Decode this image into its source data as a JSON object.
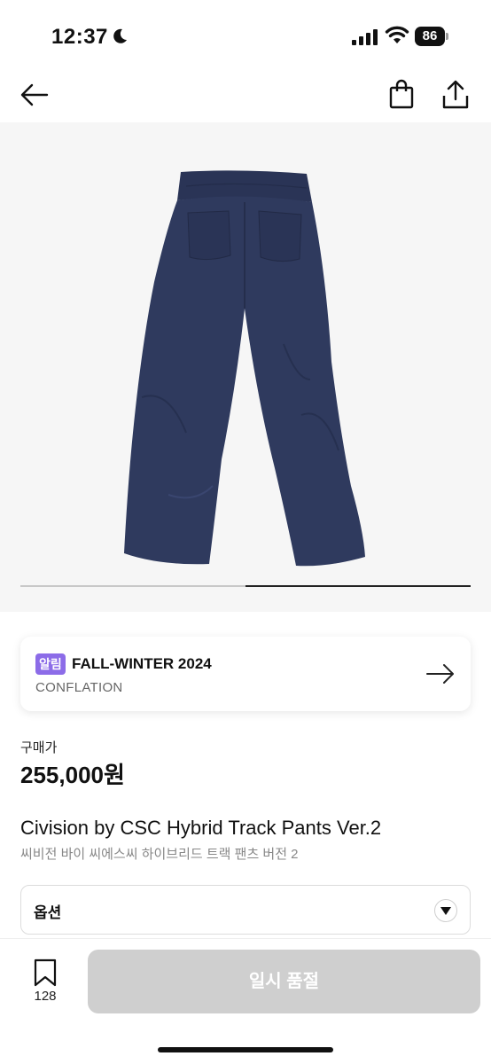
{
  "status_bar": {
    "time": "12:37",
    "battery": "86",
    "icons": [
      "moon-icon",
      "signal-icon",
      "wifi-icon",
      "battery-icon"
    ]
  },
  "nav": {
    "icons": [
      "back-arrow-icon",
      "shopping-bag-icon",
      "share-icon"
    ]
  },
  "gallery": {
    "image": "navy-track-pants-back-view",
    "progress_fraction": 0.5,
    "colors": {
      "pants": "#2f3a5e",
      "background": "#f6f6f6"
    }
  },
  "notice": {
    "badge": "알림",
    "title": "FALL-WINTER 2024",
    "subtitle": "CONFLATION",
    "badge_color": "#8c6ce8",
    "icon": "arrow-right-icon"
  },
  "price": {
    "label": "구매가",
    "value": "255,000원"
  },
  "product": {
    "name": "Civision by CSC Hybrid Track Pants Ver.2",
    "name_ko": "씨비전 바이 씨에스씨 하이브리드 트랙 팬츠 버전 2"
  },
  "options": {
    "label": "옵션",
    "icon": "caret-down-icon"
  },
  "bottom_bar": {
    "wish_count": "128",
    "soldout_label": "일시 품절",
    "button_color": "#cfcfcf"
  }
}
